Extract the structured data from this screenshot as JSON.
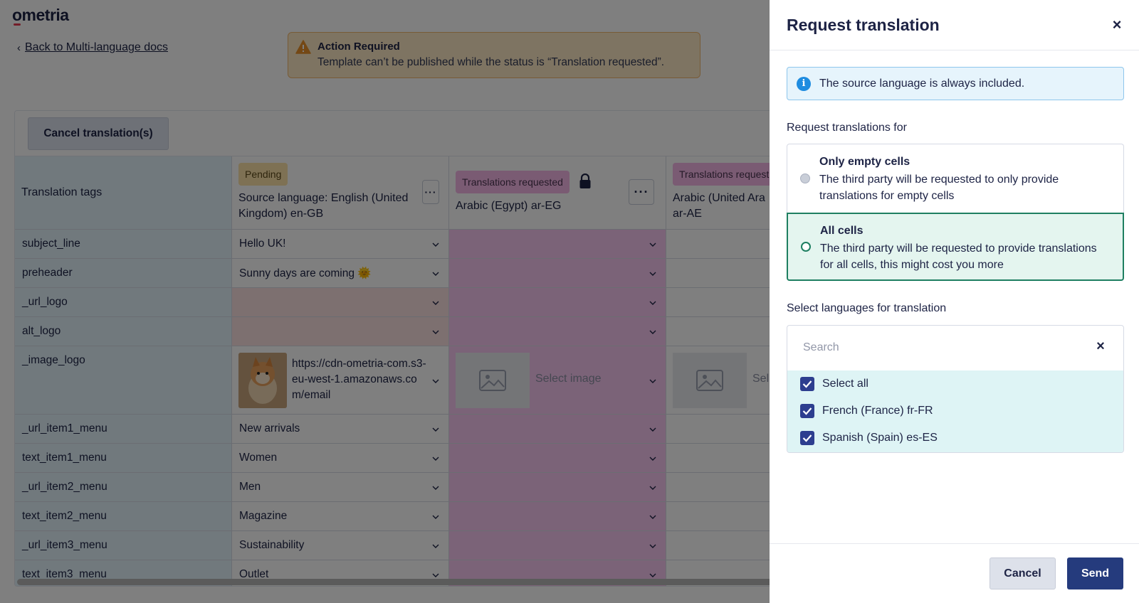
{
  "app": {
    "logo_text": "ometria"
  },
  "nav": {
    "back_label": "Back to Multi-language docs"
  },
  "alert": {
    "title": "Action Required",
    "message": "Template can’t be published while the status is “Translation requested”."
  },
  "toolbar": {
    "cancel_translations_label": "Cancel translation(s)"
  },
  "table": {
    "tags_header": "Translation tags",
    "columns": [
      {
        "badge": "Pending",
        "title": "Source language: English (United Kingdom) en-GB"
      },
      {
        "badge": "Translations requested",
        "title": "Arabic (Egypt) ar-EG"
      },
      {
        "badge": "Translations request",
        "title": "Arabic (United Ara\nar-AE"
      }
    ],
    "rows": [
      {
        "tag": "subject_line",
        "value": "Hello UK!"
      },
      {
        "tag": "preheader",
        "value": "Sunny days are coming 🌞"
      },
      {
        "tag": "_url_logo",
        "value": ""
      },
      {
        "tag": "alt_logo",
        "value": ""
      },
      {
        "tag": "_image_logo",
        "value": "https://cdn-ometria-com.s3-eu-west-1.amazonaws.com/email"
      },
      {
        "tag": "_url_item1_menu",
        "value": "New arrivals"
      },
      {
        "tag": "text_item1_menu",
        "value": "Women"
      },
      {
        "tag": "_url_item2_menu",
        "value": "Men"
      },
      {
        "tag": "text_item2_menu",
        "value": "Magazine"
      },
      {
        "tag": "_url_item3_menu",
        "value": "Sustainability"
      },
      {
        "tag": "text_item3_menu",
        "value": "Outlet"
      }
    ],
    "select_image_label": "Select image",
    "select_image_label_cut": "Sel"
  },
  "drawer": {
    "title": "Request translation",
    "info": "The source language is always included.",
    "request_for_label": "Request translations for",
    "options": [
      {
        "title": "Only empty cells",
        "description": "The third party will be requested to only provide translations for empty cells",
        "selected": false
      },
      {
        "title": "All cells",
        "description": "The third party will be requested to provide translations for all cells, this might cost you more",
        "selected": true
      }
    ],
    "languages_label": "Select languages for translation",
    "search_placeholder": "Search",
    "languages": [
      {
        "label": "Select all",
        "checked": true
      },
      {
        "label": "French (France) fr-FR",
        "checked": true
      },
      {
        "label": "Spanish (Spain) es-ES",
        "checked": true
      }
    ],
    "cancel_label": "Cancel",
    "send_label": "Send"
  },
  "colors": {
    "accent": "#253b7d",
    "selected_option_border": "#1e7f61",
    "info": "#1e8ce0",
    "requested_cell": "#f7c6f0"
  }
}
